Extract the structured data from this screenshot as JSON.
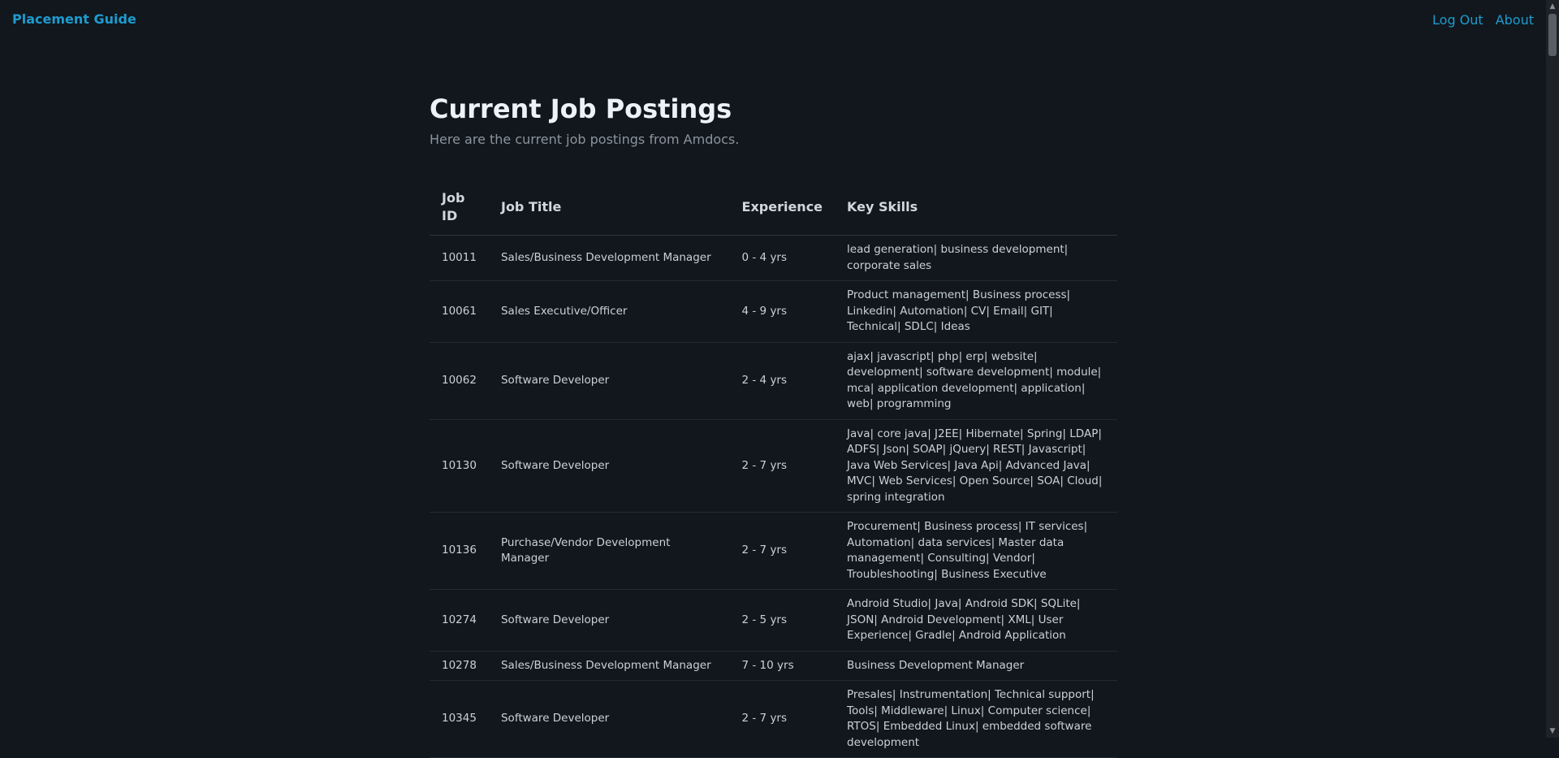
{
  "navbar": {
    "brand": "Placement Guide",
    "links": [
      "Log Out",
      "About"
    ]
  },
  "page": {
    "title": "Current Job Postings",
    "subtitle": "Here are the current job postings from Amdocs."
  },
  "table": {
    "headers": [
      "Job ID",
      "Job Title",
      "Experience",
      "Key Skills"
    ],
    "rows": [
      [
        "10011",
        "Sales/Business Development Manager",
        "0 - 4 yrs",
        "lead generation| business development| corporate sales"
      ],
      [
        "10061",
        "Sales Executive/Officer",
        "4 - 9 yrs",
        "Product management| Business process| Linkedin| Automation| CV| Email| GIT| Technical| SDLC| Ideas"
      ],
      [
        "10062",
        "Software Developer",
        "2 - 4 yrs",
        "ajax| javascript| php| erp| website| development| software development| module| mca| application development| application| web| programming"
      ],
      [
        "10130",
        "Software Developer",
        "2 - 7 yrs",
        "Java| core java| J2EE| Hibernate| Spring| LDAP| ADFS| Json| SOAP| jQuery| REST| Javascript| Java Web Services| Java Api| Advanced Java| MVC| Web Services| Open Source| SOA| Cloud| spring integration"
      ],
      [
        "10136",
        "Purchase/Vendor Development Manager",
        "2 - 7 yrs",
        "Procurement| Business process| IT services| Automation| data services| Master data management| Consulting| Vendor| Troubleshooting| Business Executive"
      ],
      [
        "10274",
        "Software Developer",
        "2 - 5 yrs",
        "Android Studio| Java| Android SDK| SQLite| JSON| Android Development| XML| User Experience| Gradle| Android Application"
      ],
      [
        "10278",
        "Sales/Business Development Manager",
        "7 - 10 yrs",
        "Business Development Manager"
      ],
      [
        "10345",
        "Software Developer",
        "2 - 7 yrs",
        "Presales| Instrumentation| Technical support| Tools| Middleware| Linux| Computer science| RTOS| Embedded Linux| embedded software development"
      ]
    ]
  },
  "scrollbar": {
    "up_icon": "scroll-up-arrow-icon",
    "down_icon": "scroll-down-arrow-icon"
  }
}
